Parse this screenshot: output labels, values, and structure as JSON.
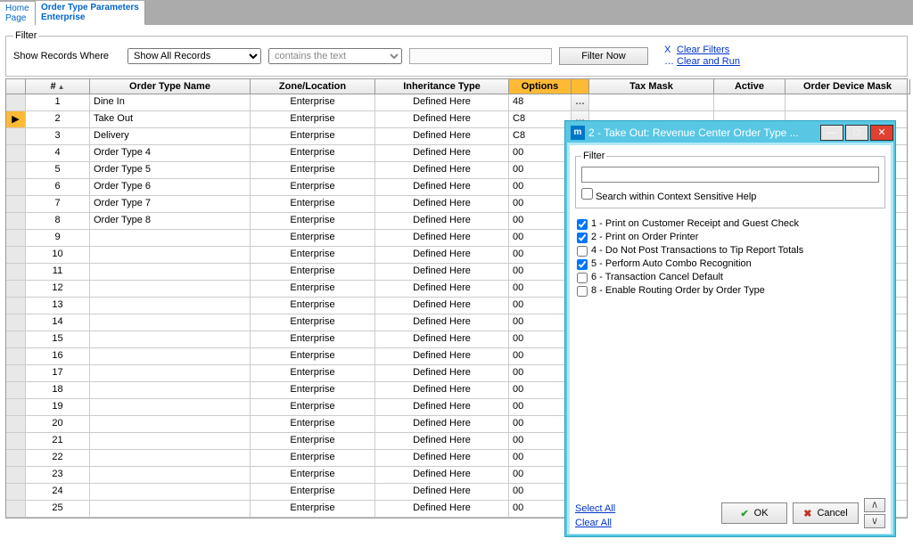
{
  "tabs": {
    "home": {
      "l1": "Home",
      "l2": "Page"
    },
    "active": {
      "l1": "Order Type Parameters",
      "l2": "Enterprise"
    }
  },
  "filter": {
    "legend": "Filter",
    "label": "Show Records Where",
    "select1": "Show All Records",
    "select2_ph": "contains the text",
    "button": "Filter Now",
    "clear_filters": "Clear Filters",
    "clear_run": "Clear and Run"
  },
  "headers": {
    "num": "#",
    "name": "Order Type Name",
    "zone": "Zone/Location",
    "inherit": "Inheritance Type",
    "options": "Options",
    "tax": "Tax Mask",
    "active": "Active",
    "device": "Order Device Mask"
  },
  "rows": [
    {
      "n": "1",
      "name": "Dine In",
      "zone": "Enterprise",
      "inherit": "Defined Here",
      "opt": "48"
    },
    {
      "n": "2",
      "name": "Take Out",
      "zone": "Enterprise",
      "inherit": "Defined Here",
      "opt": "C8",
      "sel": true
    },
    {
      "n": "3",
      "name": "Delivery",
      "zone": "Enterprise",
      "inherit": "Defined Here",
      "opt": "C8"
    },
    {
      "n": "4",
      "name": "Order Type 4",
      "zone": "Enterprise",
      "inherit": "Defined Here",
      "opt": "00"
    },
    {
      "n": "5",
      "name": "Order Type 5",
      "zone": "Enterprise",
      "inherit": "Defined Here",
      "opt": "00"
    },
    {
      "n": "6",
      "name": "Order Type 6",
      "zone": "Enterprise",
      "inherit": "Defined Here",
      "opt": "00"
    },
    {
      "n": "7",
      "name": "Order Type 7",
      "zone": "Enterprise",
      "inherit": "Defined Here",
      "opt": "00"
    },
    {
      "n": "8",
      "name": "Order Type 8",
      "zone": "Enterprise",
      "inherit": "Defined Here",
      "opt": "00"
    },
    {
      "n": "9",
      "name": "",
      "zone": "Enterprise",
      "inherit": "Defined Here",
      "opt": "00"
    },
    {
      "n": "10",
      "name": "",
      "zone": "Enterprise",
      "inherit": "Defined Here",
      "opt": "00"
    },
    {
      "n": "11",
      "name": "",
      "zone": "Enterprise",
      "inherit": "Defined Here",
      "opt": "00"
    },
    {
      "n": "12",
      "name": "",
      "zone": "Enterprise",
      "inherit": "Defined Here",
      "opt": "00"
    },
    {
      "n": "13",
      "name": "",
      "zone": "Enterprise",
      "inherit": "Defined Here",
      "opt": "00"
    },
    {
      "n": "14",
      "name": "",
      "zone": "Enterprise",
      "inherit": "Defined Here",
      "opt": "00"
    },
    {
      "n": "15",
      "name": "",
      "zone": "Enterprise",
      "inherit": "Defined Here",
      "opt": "00"
    },
    {
      "n": "16",
      "name": "",
      "zone": "Enterprise",
      "inherit": "Defined Here",
      "opt": "00"
    },
    {
      "n": "17",
      "name": "",
      "zone": "Enterprise",
      "inherit": "Defined Here",
      "opt": "00"
    },
    {
      "n": "18",
      "name": "",
      "zone": "Enterprise",
      "inherit": "Defined Here",
      "opt": "00"
    },
    {
      "n": "19",
      "name": "",
      "zone": "Enterprise",
      "inherit": "Defined Here",
      "opt": "00"
    },
    {
      "n": "20",
      "name": "",
      "zone": "Enterprise",
      "inherit": "Defined Here",
      "opt": "00"
    },
    {
      "n": "21",
      "name": "",
      "zone": "Enterprise",
      "inherit": "Defined Here",
      "opt": "00"
    },
    {
      "n": "22",
      "name": "",
      "zone": "Enterprise",
      "inherit": "Defined Here",
      "opt": "00"
    },
    {
      "n": "23",
      "name": "",
      "zone": "Enterprise",
      "inherit": "Defined Here",
      "opt": "00"
    },
    {
      "n": "24",
      "name": "",
      "zone": "Enterprise",
      "inherit": "Defined Here",
      "opt": "00"
    },
    {
      "n": "25",
      "name": "",
      "zone": "Enterprise",
      "inherit": "Defined Here",
      "opt": "00"
    }
  ],
  "dialog": {
    "title": "2 - Take Out: Revenue Center Order Type ...",
    "filter_legend": "Filter",
    "search_context": "Search within Context Sensitive Help",
    "options": [
      {
        "label": "1 - Print on Customer Receipt and Guest Check",
        "checked": true
      },
      {
        "label": "2 - Print on Order Printer",
        "checked": true
      },
      {
        "label": "4 - Do Not Post Transactions to Tip Report Totals",
        "checked": false
      },
      {
        "label": "5 - Perform Auto Combo Recognition",
        "checked": true
      },
      {
        "label": "6 - Transaction Cancel Default",
        "checked": false
      },
      {
        "label": "8 - Enable Routing Order by Order Type",
        "checked": false
      }
    ],
    "select_all": "Select All",
    "clear_all": "Clear All",
    "ok": "OK",
    "cancel": "Cancel",
    "up": "/\\",
    "down": "\\/"
  }
}
